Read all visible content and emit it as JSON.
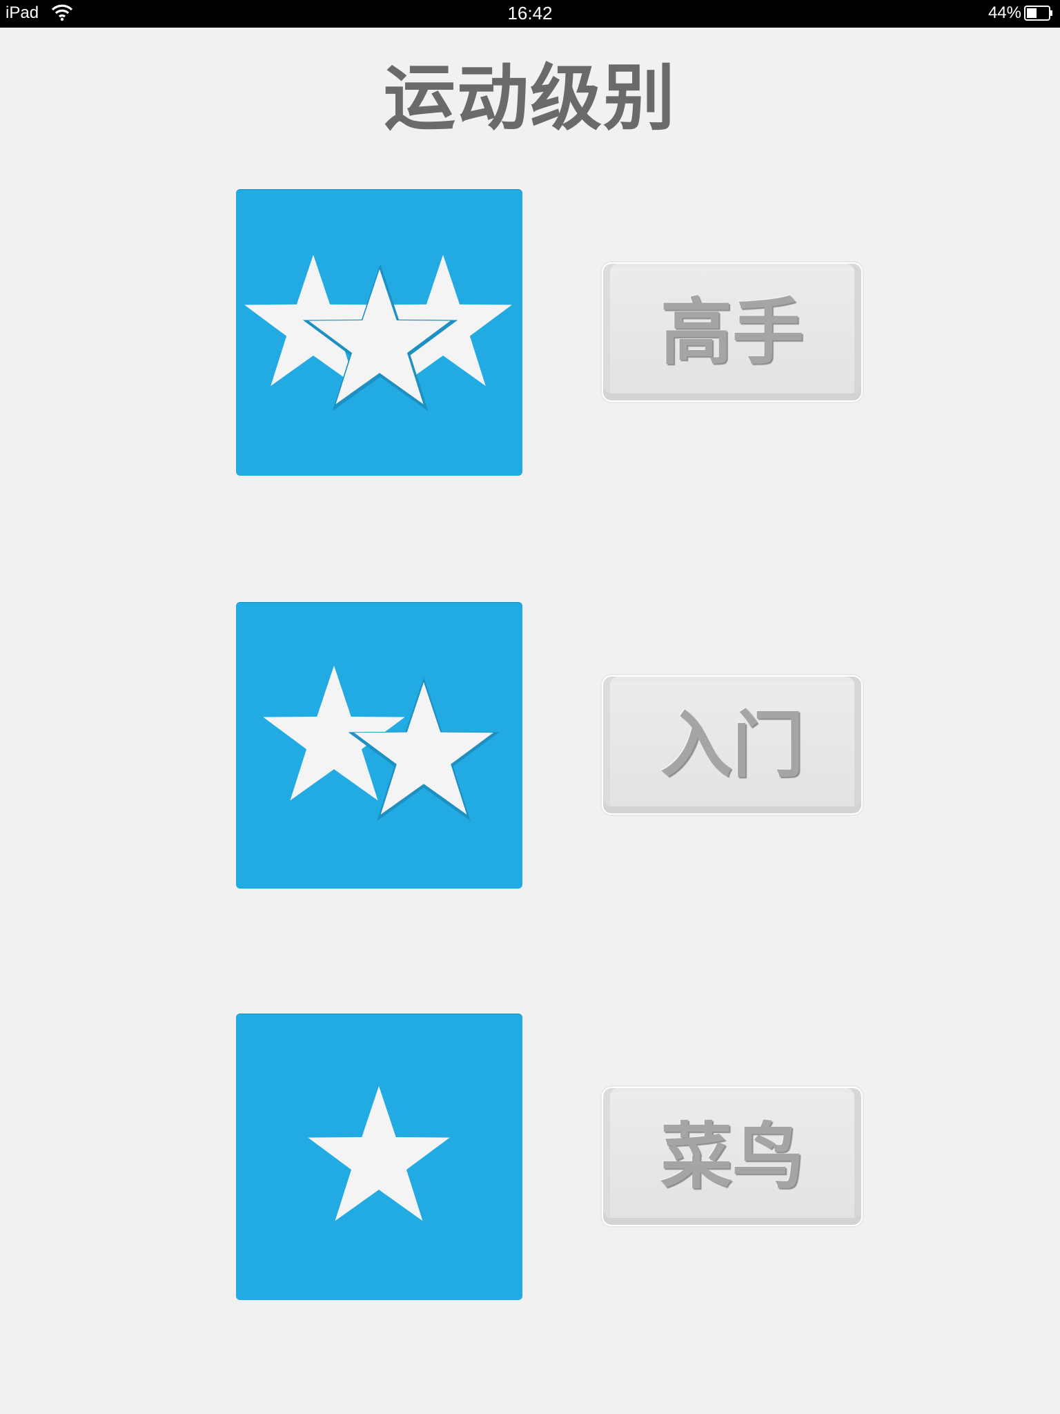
{
  "status_bar": {
    "device": "iPad",
    "time": "16:42",
    "battery_percent": "44%",
    "wifi_icon": "wifi-icon",
    "battery_icon": "battery-icon"
  },
  "page": {
    "title": "运动级别"
  },
  "levels": [
    {
      "stars": 3,
      "label": "高手",
      "icon": "star-icon"
    },
    {
      "stars": 2,
      "label": "入门",
      "icon": "star-icon"
    },
    {
      "stars": 1,
      "label": "菜鸟",
      "icon": "star-icon"
    }
  ],
  "colors": {
    "card": "#22aae2",
    "star": "#f4f4f4",
    "title": "#6a6a6a",
    "button_text": "#a5a5a5",
    "background": "#f1f1f1"
  }
}
